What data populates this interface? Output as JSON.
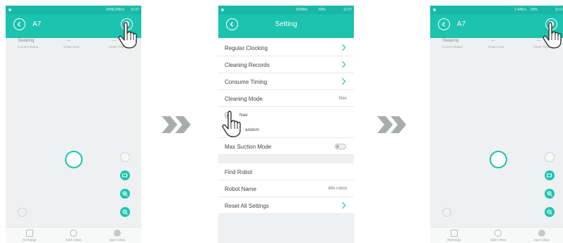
{
  "colors": {
    "accent": "#1cc3ae",
    "status_bar": "#18b8a6",
    "background": "#eef0f1"
  },
  "screen_home": {
    "status_bar": {
      "speed": "2.94K/s",
      "battery": "60%",
      "time": "11:07"
    },
    "title": "A7",
    "status": {
      "value": "Sleeping",
      "label": "Current Status"
    },
    "clean_area": {
      "value": "---",
      "label": "Clean Area"
    },
    "clean_time": {
      "value": "---",
      "label": "Clean Time"
    },
    "bottom_nav": [
      {
        "label": "Recharge",
        "icon": "house-icon"
      },
      {
        "label": "Start Clean",
        "icon": "play-icon"
      },
      {
        "label": "Spot Clean",
        "icon": "spot-icon"
      }
    ]
  },
  "screen_settings": {
    "status_bar": {
      "speed": "834B/s",
      "battery": "60%",
      "time": "11:07"
    },
    "title": "Setting",
    "rows": {
      "regular_clocking": "Regular Clocking",
      "cleaning_records": "Cleaning Records",
      "consume_timing": "Consume Timing",
      "cleaning_mode": "Cleaning Mode",
      "cleaning_mode_value": "Nav",
      "option_nav": "Nav",
      "option_random": "andom",
      "max_suction_mode": "Max Suction Mode",
      "find_robot": "Find Robot",
      "robot_name": "Robot Name",
      "robot_name_value": "ilife robot",
      "reset_all_settings": "Reset All Settings"
    }
  },
  "screen_home_2": {
    "status_bar": {
      "speed": "2.94K/s",
      "battery": "60%",
      "time": "11:07"
    },
    "title": "A7",
    "status": {
      "value": "Sleeping",
      "label": "Current Status"
    },
    "clean_area": {
      "value": "---",
      "label": "Clean Area"
    },
    "clean_time": {
      "value": "---",
      "label": "Clean Time"
    },
    "bottom_nav": [
      {
        "label": "Recharge",
        "icon": "house-icon"
      },
      {
        "label": "Start Clean",
        "icon": "play-icon"
      },
      {
        "label": "Spot Clean",
        "icon": "spot-icon"
      }
    ]
  }
}
